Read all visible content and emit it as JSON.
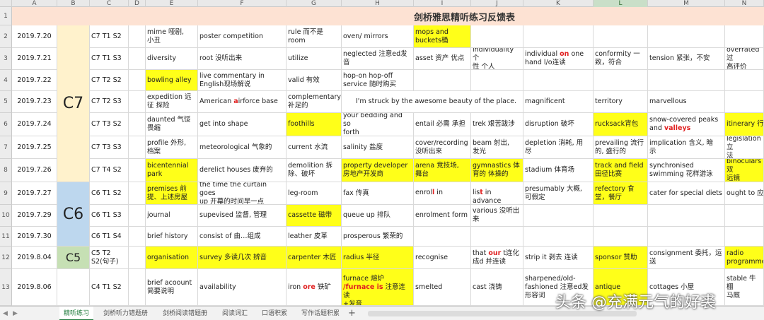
{
  "sheet": {
    "title": "剑桥雅思精听练习反馈表",
    "column_headers": [
      "A",
      "B",
      "C",
      "D",
      "E",
      "F",
      "G",
      "H",
      "I",
      "J",
      "K",
      "L",
      "M",
      "N"
    ],
    "row_numbers": [
      "2",
      "3",
      "4",
      "5",
      "6",
      "7",
      "8",
      "9",
      "10",
      "11",
      "12",
      "13"
    ],
    "groups": {
      "c7": "C7",
      "c6": "C6",
      "c5": "C5"
    },
    "rows": [
      {
        "date": "2019.7.20",
        "test": "C7 T1 S2",
        "e": "mime 哑剧,\n小丑",
        "f": "poster competition",
        "g": "rule 而不是\nroom",
        "h": "oven/ mirrors",
        "i": "mops and\nbuckets桶",
        "j": "",
        "k": "",
        "l": "",
        "m": "",
        "n": ""
      },
      {
        "date": "2019.7.21",
        "test": "C7 T1 S3",
        "e": "diversity",
        "f": "root 没听出来",
        "g": "utilize",
        "h": "neglected 注意ed发\n音",
        "i": "asset 资产 优点",
        "j": "individuality 个\n性 个人",
        "k_pre": "individual ",
        "k_red": "on",
        "k_post": " one\nhand l/o连读",
        "l": "conformity 一\n致，符合",
        "m": "tension 紧张，不安",
        "n": "overrated 过\n高评价"
      },
      {
        "date": "2019.7.22",
        "test": "C7 T2 S2",
        "e": "bowling alley",
        "f": "live commentary in\nEnglish现场解说",
        "g": "valid 有效",
        "h": "hop-on hop-off\nservice 随时购买",
        "i": "",
        "j": "",
        "k": "",
        "l": "",
        "m": "",
        "n": ""
      },
      {
        "date": "2019.7.23",
        "test": "C7 T2 S3",
        "e": "expedition 远\n征 探险",
        "f_pre": "American ",
        "f_red": "a",
        "f_post": "irforce base",
        "g": "complementary\n补足的",
        "h": "I'm struck by the awesome beauty of the place.",
        "k": "magnificent",
        "l": "territory",
        "m": "marvellous",
        "n": ""
      },
      {
        "date": "2019.7.24",
        "test": "C7 T3 S2",
        "e": "daunted 气馁\n畏缩",
        "f": "get into shape",
        "g": "foothills",
        "h": "your bedding and so\nforth",
        "i": "entail 必需 承担",
        "j": "trek 艰苦跋涉",
        "k": "disruption 破坏",
        "l": "rucksack背包",
        "m_pre": "snow-covered peaks\nand ",
        "m_red": "valleys",
        "n": "itinerary 行程"
      },
      {
        "date": "2019.7.25",
        "test": "C7 T3 S3",
        "e": "profile 外形,\n档案",
        "f": "meteorological 气象的",
        "g": "current 水流",
        "h": "salinity 盐度",
        "i": "cover/recording\n没听出来",
        "j": "beam 射出,\n发光",
        "k": "depletion 消耗, 用\n尽",
        "l": "prevailing 流行\n的, 盛行的",
        "m": "implication 含义, 暗\n示",
        "n": "legislation 立\n法"
      },
      {
        "date": "2019.7.26",
        "test": "C7 T4 S2",
        "e": "bicentennial\npark",
        "f": "derelict houses 废弃的",
        "g": "demolition 拆\n除、破坏",
        "h": "property developer\n房地产开发商",
        "i": "arena 竞技场,\n舞台",
        "j": "gymnastics 体\n育的 体操的",
        "k": "stadium 体育场",
        "l": "track and field\n田径比赛",
        "m": "synchronised\nswimming 花样游泳",
        "n": "binoculars 双\n远镜"
      },
      {
        "date": "2019.7.27",
        "test": "C6 T1 S2",
        "e": "premises 前\n提、上述房屋",
        "f": "the time the curtain goes\nup 开幕的时间早一点",
        "g": "leg-room",
        "h": "fax 传真",
        "i_pre": "enrol",
        "i_red": "l",
        "i_post": " in",
        "j_pre": "lis",
        "j_red": "t",
        "j_post": " in advance",
        "k": "presumably 大概,\n可假定",
        "l": "refectory 食\n堂，餐厅",
        "m": "cater for special diets",
        "n": "ought to 应当"
      },
      {
        "date": "2019.7.29",
        "test": "C6 T1 S3",
        "e": "journal",
        "f": "supevised 监督, 管理",
        "g": "cassette 磁带",
        "h": "queue up 排队",
        "i": "enrolment form",
        "j": "various 没听出\n来",
        "k": "",
        "l": "",
        "m": "",
        "n": ""
      },
      {
        "date": "2019.7.30",
        "test": "C6 T1 S4",
        "e": "brief history",
        "f": "consist of 由…组成",
        "g": "leather 皮革",
        "h": "prosperous 繁荣的",
        "i": "",
        "j": "",
        "k": "",
        "l": "",
        "m": "",
        "n": ""
      },
      {
        "date": "2019.8.04",
        "test": "C5 T2\nS2(句子)",
        "e": "organisation",
        "f": "survey 多读几次 辨音",
        "g": "carpenter 木匠",
        "h": "radius 半径",
        "i": "recognise",
        "j_pre": "that ",
        "j_red": "our",
        "j_post": " t连化\n成d 并连读",
        "k": "strip it 剥去 连读",
        "l": "sponsor 赞助",
        "m": "consignment 委托，运\n送",
        "n": "radio\nprogramme"
      },
      {
        "date": "2019.8.06",
        "test": "C4 T1 S2",
        "e": "brief acoount\n简要说明",
        "f": "availability",
        "g_pre": "iron ",
        "g_red": "ore",
        "g_post": " 铁矿",
        "h_pre": "furnace 熔炉\n",
        "h_red": "/furnace is",
        "h_post": " 注意连读\n+发音",
        "i": "smelted",
        "j": "cast 浇铸",
        "k": "sharpened/old-\nfashioned 注意ed发\n形容词",
        "l": "antique",
        "m": "cottages 小屋",
        "n": "stable 牛棚\n马厩"
      }
    ]
  },
  "tabs": [
    "精听练习",
    "剑桥听力错题册",
    "剑桥阅读错题册",
    "阅读词汇",
    "口语积累",
    "写作话题积累"
  ],
  "add_tab": "+",
  "tab_nav_prev": "◀",
  "tab_nav_next": "▶",
  "watermark": "头条 @充满元气的好裘",
  "colors": {
    "highlight": "#ffff19",
    "title_bg": "#fde2d3",
    "c7_bg": "#fff2cc",
    "c6_bg": "#bdd7ee",
    "c5_bg": "#c6e0b4",
    "accent_red": "#e02020",
    "active_tab": "#1d7a3a"
  }
}
